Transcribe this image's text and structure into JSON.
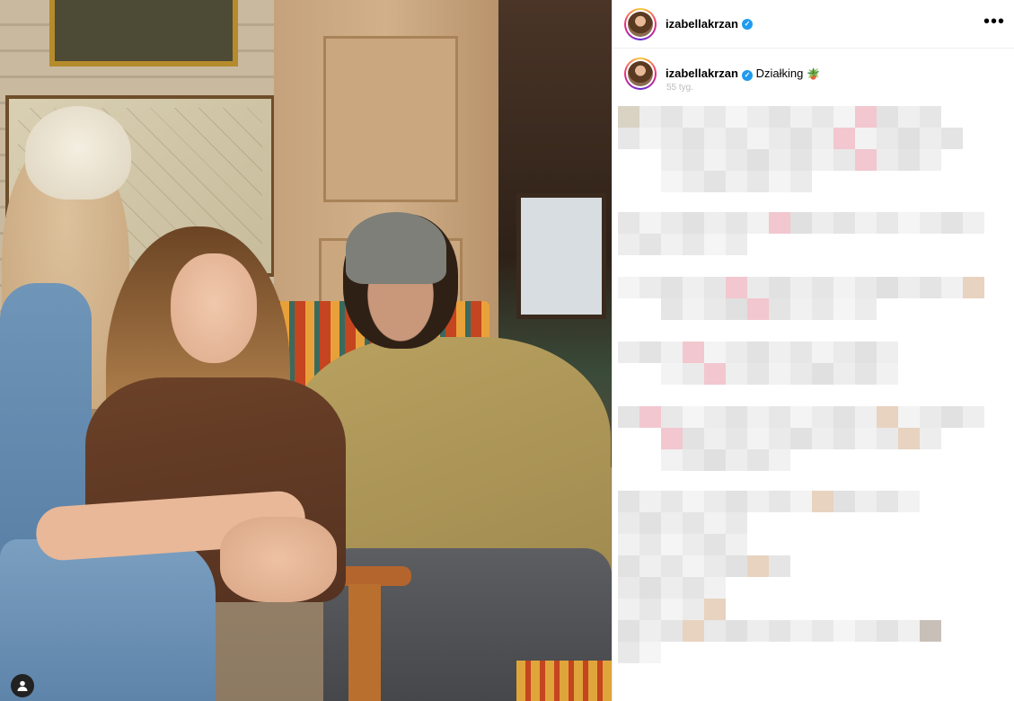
{
  "post": {
    "username": "izabellakrzan",
    "verified": true,
    "caption": "Działking",
    "caption_emoji": "🪴",
    "time_ago": "55 tyg.",
    "more_icon": "more-horizontal-icon",
    "comments_blurred": true
  },
  "photo": {
    "tagged_user_icon": "user-tag-icon"
  },
  "colors": {
    "verified_badge": "#1f9bf0",
    "story_ring": [
      "#f9ce34",
      "#ee2a7b",
      "#6228d7"
    ],
    "blur_gray": "#e6e6e6"
  }
}
